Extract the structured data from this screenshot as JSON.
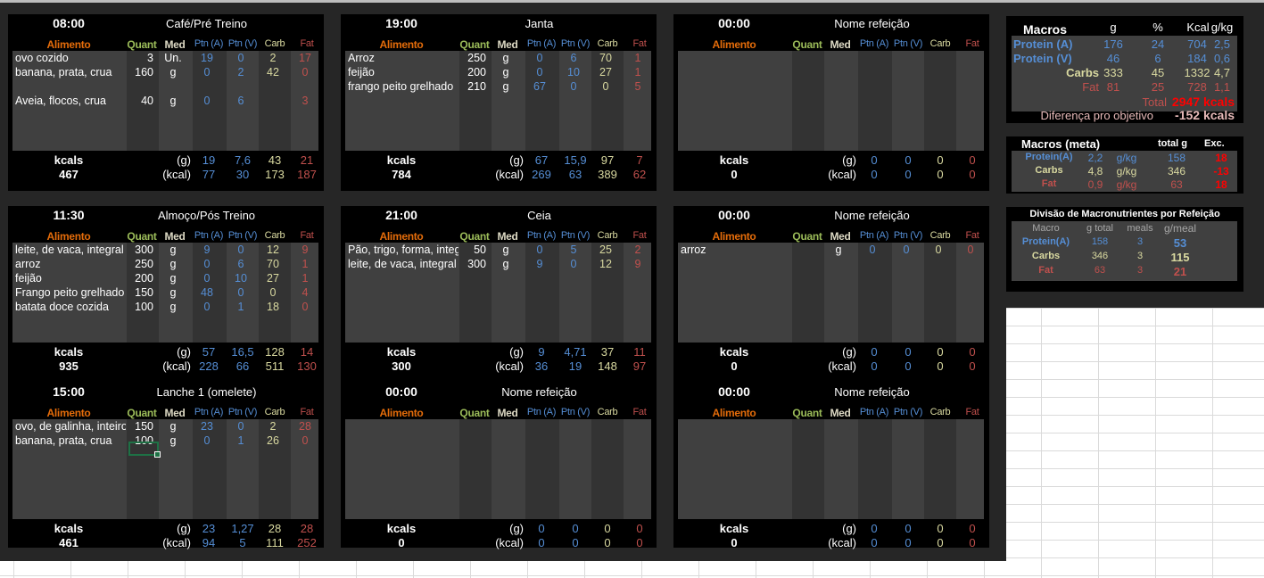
{
  "headers": {
    "alimento": "Alimento",
    "quant": "Quant",
    "med": "Med",
    "ptnA": "Ptn (A)",
    "ptnV": "Ptn (V)",
    "carb": "Carb",
    "fat": "Fat",
    "kcals": "kcals",
    "g": "(g)",
    "kcal": "(kcal)"
  },
  "meals": [
    {
      "time": "08:00",
      "name": "Café/Pré Treino",
      "rows": [
        {
          "alimento": "ovo cozido",
          "quant": "3",
          "med": "Un.",
          "ptnA": "19",
          "ptnV": "0",
          "carb": "2",
          "fat": "17"
        },
        {
          "alimento": "banana, prata, crua",
          "quant": "160",
          "med": "g",
          "ptnA": "0",
          "ptnV": "2",
          "carb": "42",
          "fat": "0"
        },
        {
          "alimento": "",
          "quant": "",
          "med": "",
          "ptnA": "",
          "ptnV": "",
          "carb": "",
          "fat": ""
        },
        {
          "alimento": "Aveia, flocos, crua",
          "quant": "40",
          "med": "g",
          "ptnA": "0",
          "ptnV": "6",
          "carb": "",
          "fat": "3"
        }
      ],
      "kcals": "467",
      "g": {
        "ptnA": "19",
        "ptnV": "7,6",
        "carb": "43",
        "fat": "21"
      },
      "kcal": {
        "ptnA": "77",
        "ptnV": "30",
        "carb": "173",
        "fat": "187"
      }
    },
    {
      "time": "19:00",
      "name": "Janta",
      "rows": [
        {
          "alimento": "Arroz",
          "quant": "250",
          "med": "g",
          "ptnA": "0",
          "ptnV": "6",
          "carb": "70",
          "fat": "1"
        },
        {
          "alimento": "feijão",
          "quant": "200",
          "med": "g",
          "ptnA": "0",
          "ptnV": "10",
          "carb": "27",
          "fat": "1"
        },
        {
          "alimento": "frango peito grelhado",
          "quant": "210",
          "med": "g",
          "ptnA": "67",
          "ptnV": "0",
          "carb": "0",
          "fat": "5"
        }
      ],
      "kcals": "784",
      "g": {
        "ptnA": "67",
        "ptnV": "15,9",
        "carb": "97",
        "fat": "7"
      },
      "kcal": {
        "ptnA": "269",
        "ptnV": "63",
        "carb": "389",
        "fat": "62"
      }
    },
    {
      "time": "00:00",
      "name": "Nome refeição",
      "rows": [],
      "kcals": "0",
      "g": {
        "ptnA": "0",
        "ptnV": "0",
        "carb": "0",
        "fat": "0"
      },
      "kcal": {
        "ptnA": "0",
        "ptnV": "0",
        "carb": "0",
        "fat": "0"
      }
    },
    {
      "time": "11:30",
      "name": "Almoço/Pós Treino",
      "rows": [
        {
          "alimento": "leite, de vaca, integral",
          "quant": "300",
          "med": "g",
          "ptnA": "9",
          "ptnV": "0",
          "carb": "12",
          "fat": "9"
        },
        {
          "alimento": "arroz",
          "quant": "250",
          "med": "g",
          "ptnA": "0",
          "ptnV": "6",
          "carb": "70",
          "fat": "1"
        },
        {
          "alimento": "feijão",
          "quant": "200",
          "med": "g",
          "ptnA": "0",
          "ptnV": "10",
          "carb": "27",
          "fat": "1"
        },
        {
          "alimento": "Frango peito grelhado",
          "quant": "150",
          "med": "g",
          "ptnA": "48",
          "ptnV": "0",
          "carb": "0",
          "fat": "4"
        },
        {
          "alimento": "batata doce cozida",
          "quant": "100",
          "med": "g",
          "ptnA": "0",
          "ptnV": "1",
          "carb": "18",
          "fat": "0"
        }
      ],
      "kcals": "935",
      "g": {
        "ptnA": "57",
        "ptnV": "16,5",
        "carb": "128",
        "fat": "14"
      },
      "kcal": {
        "ptnA": "228",
        "ptnV": "66",
        "carb": "511",
        "fat": "130"
      }
    },
    {
      "time": "21:00",
      "name": "Ceia",
      "rows": [
        {
          "alimento": "Pão, trigo, forma, integral",
          "quant": "50",
          "med": "g",
          "ptnA": "0",
          "ptnV": "5",
          "carb": "25",
          "fat": "2"
        },
        {
          "alimento": "leite, de vaca, integral",
          "quant": "300",
          "med": "g",
          "ptnA": "9",
          "ptnV": "0",
          "carb": "12",
          "fat": "9"
        }
      ],
      "kcals": "300",
      "g": {
        "ptnA": "9",
        "ptnV": "4,71",
        "carb": "37",
        "fat": "11"
      },
      "kcal": {
        "ptnA": "36",
        "ptnV": "19",
        "carb": "148",
        "fat": "97"
      }
    },
    {
      "time": "00:00",
      "name": "Nome refeição",
      "rows": [
        {
          "alimento": "arroz",
          "quant": "",
          "med": "g",
          "ptnA": "0",
          "ptnV": "0",
          "carb": "0",
          "fat": "0"
        }
      ],
      "kcals": "0",
      "g": {
        "ptnA": "0",
        "ptnV": "0",
        "carb": "0",
        "fat": "0"
      },
      "kcal": {
        "ptnA": "0",
        "ptnV": "0",
        "carb": "0",
        "fat": "0"
      }
    },
    {
      "time": "15:00",
      "name": "Lanche 1 (omelete)",
      "rows": [
        {
          "alimento": "ovo, de galinha, inteiro",
          "quant": "150",
          "med": "g",
          "ptnA": "23",
          "ptnV": "0",
          "carb": "2",
          "fat": "28"
        },
        {
          "alimento": "banana, prata, crua",
          "quant": "100",
          "med": "g",
          "ptnA": "0",
          "ptnV": "1",
          "carb": "26",
          "fat": "0"
        }
      ],
      "kcals": "461",
      "g": {
        "ptnA": "23",
        "ptnV": "1,27",
        "carb": "28",
        "fat": "28"
      },
      "kcal": {
        "ptnA": "94",
        "ptnV": "5",
        "carb": "111",
        "fat": "252"
      }
    },
    {
      "time": "00:00",
      "name": "Nome refeição",
      "rows": [],
      "kcals": "0",
      "g": {
        "ptnA": "0",
        "ptnV": "0",
        "carb": "0",
        "fat": "0"
      },
      "kcal": {
        "ptnA": "0",
        "ptnV": "0",
        "carb": "0",
        "fat": "0"
      }
    },
    {
      "time": "00:00",
      "name": "Nome refeição",
      "rows": [],
      "kcals": "0",
      "g": {
        "ptnA": "0",
        "ptnV": "0",
        "carb": "0",
        "fat": "0"
      },
      "kcal": {
        "ptnA": "0",
        "ptnV": "0",
        "carb": "0",
        "fat": "0"
      }
    }
  ],
  "macros": {
    "title": "Macros",
    "h_g": "g",
    "h_pct": "%",
    "h_kcal": "Kcal",
    "h_gkg": "g/kg",
    "rows": [
      {
        "label": "Protein (A)",
        "g": "176",
        "pct": "24",
        "kcal": "704",
        "gkg": "2,5"
      },
      {
        "label": "Protein (V)",
        "g": "46",
        "pct": "6",
        "kcal": "184",
        "gkg": "0,6"
      },
      {
        "label": "Carbs",
        "g": "333",
        "pct": "45",
        "kcal": "1332",
        "gkg": "4,7"
      },
      {
        "label": "Fat",
        "g": "81",
        "pct": "25",
        "kcal": "728",
        "gkg": "1,1"
      }
    ],
    "total_label": "Total",
    "total_value": "2947 kcals",
    "diff_label": "Diferença pro objetivo",
    "diff_value": "-152 kcals"
  },
  "meta": {
    "title": "Macros (meta)",
    "h_total": "total g",
    "h_exc": "Exc.",
    "rows": [
      {
        "label": "Protein(A)",
        "val": "2,2",
        "unit": "g/kg",
        "total": "158",
        "exc": "18"
      },
      {
        "label": "Carbs",
        "val": "4,8",
        "unit": "g/kg",
        "total": "346",
        "exc": "-13"
      },
      {
        "label": "Fat",
        "val": "0,9",
        "unit": "g/kg",
        "total": "63",
        "exc": "18"
      }
    ]
  },
  "division": {
    "title": "Divisão de Macronutrientes por Refeição",
    "h_macro": "Macro",
    "h_total": "g total",
    "h_meals": "meals",
    "h_gmeal": "g/meal",
    "rows": [
      {
        "label": "Protein(A)",
        "total": "158",
        "meals": "3",
        "gmeal": "53"
      },
      {
        "label": "Carbs",
        "total": "346",
        "meals": "3",
        "gmeal": "115"
      },
      {
        "label": "Fat",
        "total": "63",
        "meals": "3",
        "gmeal": "21"
      }
    ]
  }
}
